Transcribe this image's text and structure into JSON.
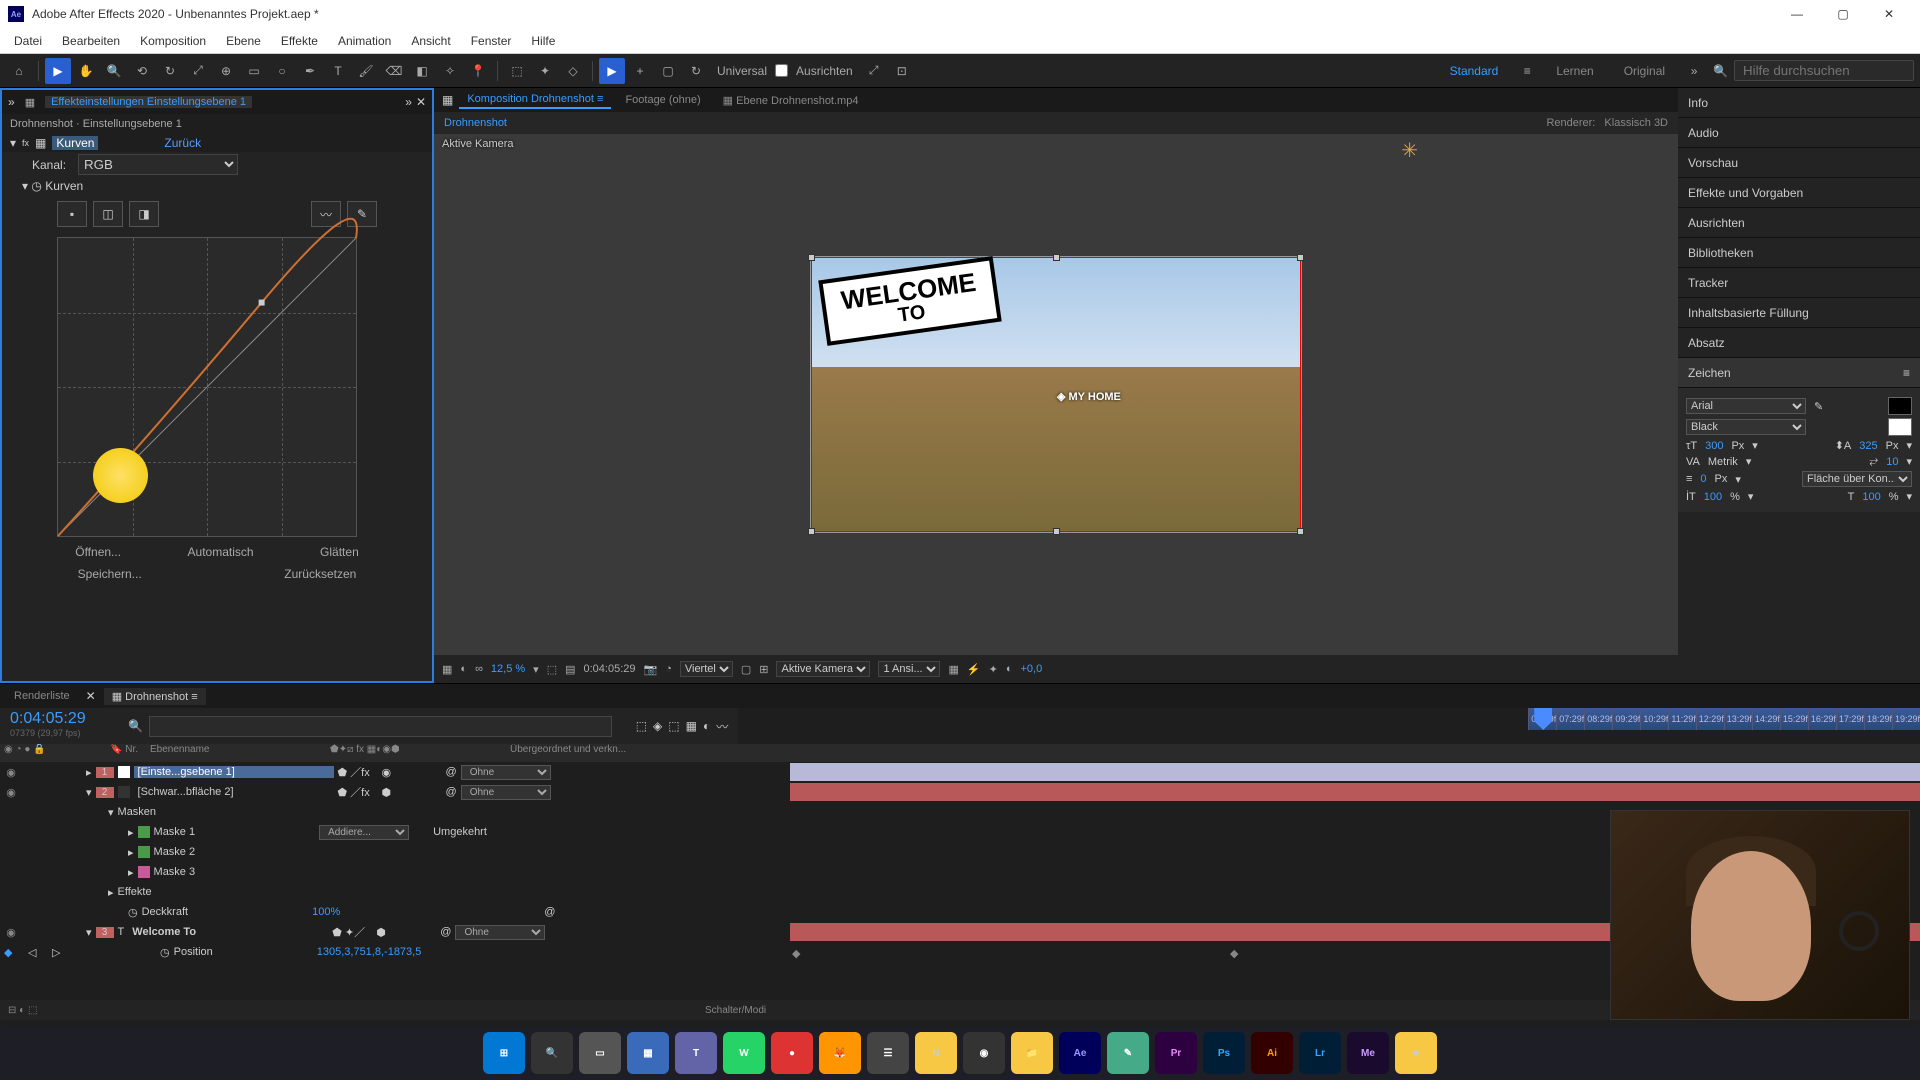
{
  "titlebar": {
    "title": "Adobe After Effects 2020 - Unbenanntes Projekt.aep *"
  },
  "menu": [
    "Datei",
    "Bearbeiten",
    "Komposition",
    "Ebene",
    "Effekte",
    "Animation",
    "Ansicht",
    "Fenster",
    "Hilfe"
  ],
  "toolbar": {
    "universal": "Universal",
    "ausrichten": "Ausrichten",
    "workspaces": [
      "Standard",
      "Lernen",
      "Original"
    ],
    "search_ph": "Hilfe durchsuchen"
  },
  "leftpanel": {
    "tab_label": "Effekteinstellungen",
    "tab_layer": "Einstellungsebene 1",
    "subhead": "Drohnenshot · Einstellungsebene 1",
    "fx_name": "Kurven",
    "reset": "Zurück",
    "kanal_label": "Kanal:",
    "kanal_value": "RGB",
    "kurven_label": "Kurven",
    "actions": {
      "open": "Öffnen...",
      "auto": "Automatisch",
      "smooth": "Glätten",
      "save": "Speichern...",
      "reset": "Zurücksetzen"
    }
  },
  "center": {
    "tab_comp": "Komposition",
    "tab_comp_name": "Drohnenshot",
    "tab_footage": "Footage",
    "tab_footage_val": "(ohne)",
    "tab_layer": "Ebene",
    "tab_layer_val": "Drohnenshot.mp4",
    "breadcrumb": "Drohnenshot",
    "renderer_label": "Renderer:",
    "renderer_value": "Klassisch 3D",
    "active_cam": "Aktive Kamera",
    "sign1": "WELCOME",
    "sign2": "TO",
    "subtitle": "◈ MY HOME",
    "zoom": "12,5 %",
    "timecode": "0:04:05:29",
    "res": "Viertel",
    "view": "Aktive Kamera",
    "views": "1 Ansi...",
    "exposure": "+0,0"
  },
  "rightpanels": [
    "Info",
    "Audio",
    "Vorschau",
    "Effekte und Vorgaben",
    "Ausrichten",
    "Bibliotheken",
    "Tracker",
    "Inhaltsbasierte Füllung",
    "Absatz",
    "Zeichen"
  ],
  "char": {
    "font": "Arial",
    "weight": "Black",
    "size": "300",
    "size_unit": "Px",
    "leading": "325",
    "leading_unit": "Px",
    "kerning": "Metrik",
    "tracking": "10",
    "stroke": "0",
    "stroke_unit": "Px",
    "stroke_label": "Fläche über Kon...",
    "vscale": "100",
    "hscale": "100",
    "pct": "%"
  },
  "timeline": {
    "tab_render": "Renderliste",
    "tab_comp": "Drohnenshot",
    "tc": "0:04:05:29",
    "tc_sub": "07379 (29,97 fps)",
    "col_name": "Ebenenname",
    "col_parent": "Übergeordnet und verkn...",
    "none": "Ohne",
    "ticks": [
      "06:29f",
      "07:29f",
      "08:29f",
      "09:29f",
      "10:29f",
      "11:29f",
      "12:29f",
      "13:29f",
      "14:29f",
      "15:29f",
      "16:29f",
      "17:29f",
      "18:29f",
      "19:29f"
    ],
    "layers": [
      {
        "num": "1",
        "name": "[Einste...gsebene 1]",
        "selected": true,
        "barcolor": "#b8b8d8"
      },
      {
        "num": "2",
        "name": "[Schwar...bfläche 2]",
        "barcolor": "#b85858"
      }
    ],
    "masken_label": "Masken",
    "masks": [
      "Maske 1",
      "Maske 2",
      "Maske 3"
    ],
    "mask_mode": "Addiere...",
    "mask_inv": "Umgekehrt",
    "effekte_label": "Effekte",
    "opacity_label": "Deckkraft",
    "opacity_val": "100",
    "opacity_pct": "%",
    "layer3": {
      "num": "3",
      "name": "Welcome To",
      "barcolor": "#b85858"
    },
    "pos_label": "Position",
    "pos_val": "1305,3,751,8,-1873,5",
    "footer_mode": "Schalter/Modi"
  },
  "taskbar_apps": [
    {
      "bg": "#0078d4",
      "txt": "⊞"
    },
    {
      "bg": "#333",
      "txt": "🔍"
    },
    {
      "bg": "#555",
      "txt": "▭"
    },
    {
      "bg": "#3a6aba",
      "txt": "▦"
    },
    {
      "bg": "#6264a7",
      "txt": "T"
    },
    {
      "bg": "#25d366",
      "txt": "W"
    },
    {
      "bg": "#d33",
      "txt": "●"
    },
    {
      "bg": "#ff9500",
      "txt": "🦊"
    },
    {
      "bg": "#444",
      "txt": "☰"
    },
    {
      "bg": "#f7c844",
      "txt": "N"
    },
    {
      "bg": "#333",
      "txt": "◉"
    },
    {
      "bg": "#f7c844",
      "txt": "📁"
    },
    {
      "bg": "#00005b",
      "txt": "Ae"
    },
    {
      "bg": "#4a8",
      "txt": "✎"
    },
    {
      "bg": "#8a2be2",
      "txt": "Pr"
    },
    {
      "bg": "#001e36",
      "txt": "Ps"
    },
    {
      "bg": "#330000",
      "txt": "Ai"
    },
    {
      "bg": "#001e36",
      "txt": "Lr"
    },
    {
      "bg": "#4b1e6b",
      "txt": "Me"
    },
    {
      "bg": "#f7c844",
      "txt": "★"
    }
  ]
}
